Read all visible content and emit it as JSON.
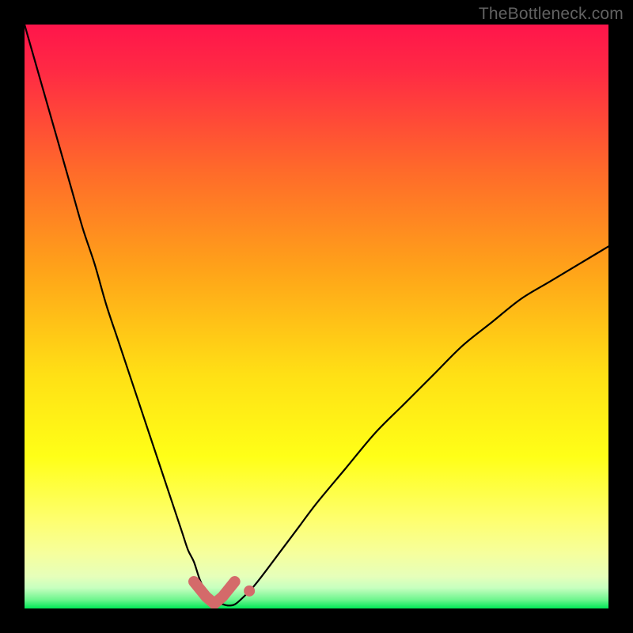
{
  "watermark": "TheBottleneck.com",
  "colors": {
    "page_bg": "#000000",
    "watermark": "#626262",
    "curve": "#000000",
    "marker": "#d46a6a",
    "gradient_top": "#ff154b",
    "gradient_mid1": "#ffa319",
    "gradient_mid2": "#ffff17",
    "gradient_mid3": "#f6ff9c",
    "gradient_bottom": "#00e756"
  },
  "chart_data": {
    "type": "line",
    "title": "",
    "xlabel": "",
    "ylabel": "",
    "xlim": [
      0,
      100
    ],
    "ylim": [
      0,
      100
    ],
    "grid": false,
    "legend": false,
    "annotations": [],
    "series": [
      {
        "name": "bottleneck-curve",
        "x": [
          0,
          2,
          4,
          6,
          8,
          10,
          12,
          14,
          16,
          18,
          20,
          22,
          24,
          26,
          27,
          28,
          29,
          30,
          31,
          32,
          33,
          34,
          35,
          36,
          37,
          39,
          41,
          44,
          47,
          50,
          55,
          60,
          65,
          70,
          75,
          80,
          85,
          90,
          95,
          100
        ],
        "y": [
          100,
          93,
          86,
          79,
          72,
          65,
          59,
          52,
          46,
          40,
          34,
          28,
          22,
          16,
          13,
          10,
          8,
          5,
          3,
          2,
          1.2,
          0.7,
          0.5,
          0.7,
          1.5,
          3.5,
          6,
          10,
          14,
          18,
          24,
          30,
          35,
          40,
          45,
          49,
          53,
          56,
          59,
          62
        ]
      }
    ],
    "markers": [
      {
        "name": "highlight-valley",
        "x_range": [
          29,
          36
        ],
        "y": 0.8
      },
      {
        "name": "highlight-dot",
        "x": 38.5,
        "y": 3.0
      }
    ]
  }
}
